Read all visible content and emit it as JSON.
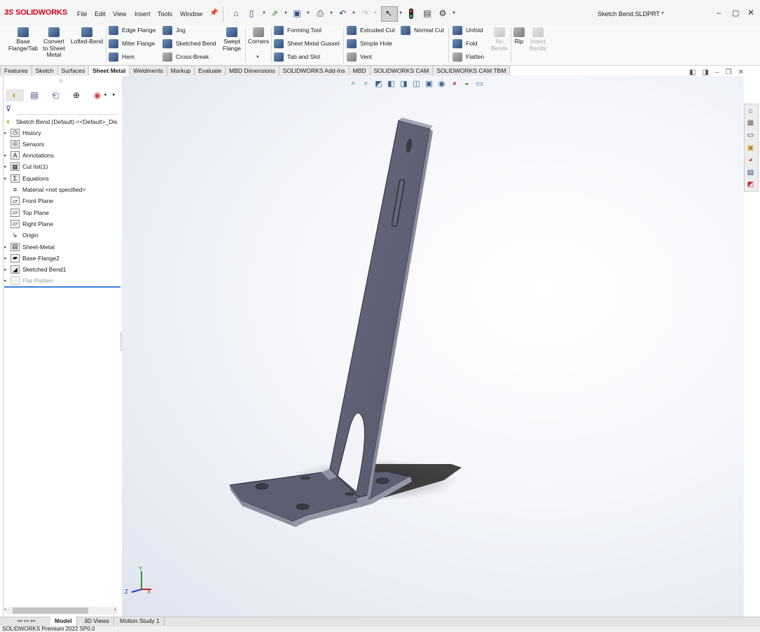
{
  "app": {
    "brand": "SOLIDWORKS",
    "brand_mark": "3S",
    "accent": "#d0021b"
  },
  "menu": [
    "File",
    "Edit",
    "View",
    "Insert",
    "Tools",
    "Window"
  ],
  "document_title": "Sketch Bend.SLDPRT *",
  "commands": {
    "base_flange": "Base Flange/Tab",
    "convert": "Convert to Sheet Metal",
    "lofted_bend": "Lofted-Bend",
    "edge_flange": "Edge Flange",
    "miter_flange": "Miter Flange",
    "hem": "Hem",
    "jog": "Jog",
    "sketched_bend": "Sketched Bend",
    "cross_break": "Cross-Break",
    "swept_flange": "Swept Flange",
    "corners": "Corners",
    "forming_tool": "Forming Tool",
    "sheet_metal_gusset": "Sheet Metal Gusset",
    "tab_and_slot": "Tab and Slot",
    "extruded_cut": "Extruded Cut",
    "simple_hole": "Simple Hole",
    "vent": "Vent",
    "normal_cut": "Normal Cut",
    "unfold": "Unfold",
    "fold": "Fold",
    "flatten": "Flatten",
    "no_bends": "No Bends",
    "rip": "Rip",
    "insert_bends": "Insert Bends"
  },
  "tabs": [
    "Features",
    "Sketch",
    "Surfaces",
    "Sheet Metal",
    "Weldments",
    "Markup",
    "Evaluate",
    "MBD Dimensions",
    "SOLIDWORKS Add-Ins",
    "MBD",
    "SOLIDWORKS CAM",
    "SOLIDWORKS CAM TBM"
  ],
  "active_tab": "Sheet Metal",
  "feature_tree": {
    "root": "Sketch Bend (Default) <<Default>_Dis",
    "items": [
      {
        "label": "History",
        "icon": "history-icon",
        "expandable": true
      },
      {
        "label": "Sensors",
        "icon": "sensors-icon",
        "expandable": false
      },
      {
        "label": "Annotations",
        "icon": "annotations-icon",
        "expandable": true
      },
      {
        "label": "Cut list(1)",
        "icon": "cut-list-icon",
        "expandable": true
      },
      {
        "label": "Equations",
        "icon": "equations-icon",
        "expandable": true
      },
      {
        "label": "Material <not specified>",
        "icon": "material-icon",
        "expandable": false
      },
      {
        "label": "Front Plane",
        "icon": "plane-icon",
        "expandable": false
      },
      {
        "label": "Top Plane",
        "icon": "plane-icon",
        "expandable": false
      },
      {
        "label": "Right Plane",
        "icon": "plane-icon",
        "expandable": false
      },
      {
        "label": "Origin",
        "icon": "origin-icon",
        "expandable": false
      },
      {
        "label": "Sheet-Metal",
        "icon": "sheet-metal-icon",
        "expandable": true
      },
      {
        "label": "Base-Flange2",
        "icon": "base-flange-icon",
        "expandable": true
      },
      {
        "label": "Sketched Bend1",
        "icon": "sketched-bend-icon",
        "expandable": true
      },
      {
        "label": "Flat-Pattern",
        "icon": "flat-pattern-icon",
        "expandable": true,
        "suppressed": true
      }
    ]
  },
  "bottom_tabs": [
    "Model",
    "3D Views",
    "Motion Study 1"
  ],
  "active_bottom_tab": "Model",
  "status": "SOLIDWORKS Premium 2022 SP0.0",
  "triad": {
    "x": "X",
    "y": "Y",
    "z": "Z"
  }
}
